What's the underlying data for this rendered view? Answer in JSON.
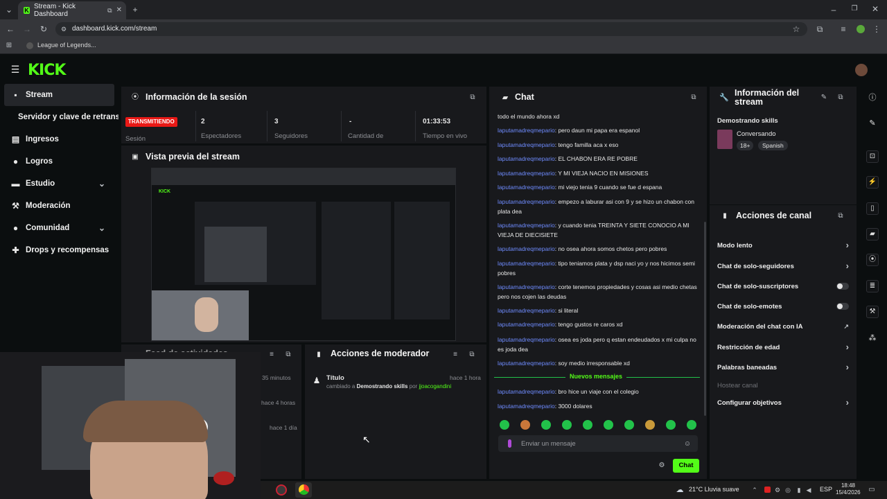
{
  "browser": {
    "tab_title": "Stream - Kick Dashboard",
    "url": "dashboard.kick.com/stream",
    "bookmark": "League of Legends..."
  },
  "sidebar": {
    "items": [
      {
        "label": "Stream",
        "icon": "stream-icon"
      },
      {
        "label": "Servidor y clave de retransmisión",
        "icon": ""
      },
      {
        "label": "Ingresos",
        "icon": "coins-icon"
      },
      {
        "label": "Logros",
        "icon": "trophy-icon"
      },
      {
        "label": "Estudio",
        "icon": "studio-icon"
      },
      {
        "label": "Moderación",
        "icon": "hammer-icon"
      },
      {
        "label": "Comunidad",
        "icon": "community-icon"
      },
      {
        "label": "Drops y recompensas",
        "icon": "gift-icon"
      }
    ]
  },
  "session": {
    "title": "Información de la sesión",
    "status": "TRANSMITIENDO",
    "status_label": "Sesión",
    "stats": [
      {
        "value": "2",
        "label": "Espectadores"
      },
      {
        "value": "3",
        "label": "Seguidores"
      },
      {
        "value": "-",
        "label": "Cantidad de"
      },
      {
        "value": "01:33:53",
        "label": "Tiempo en vivo"
      }
    ]
  },
  "preview": {
    "title": "Vista previa del stream"
  },
  "activity": {
    "title": "Feed de actividades",
    "times": [
      "35 minutos",
      "hace 4 horas",
      "hace 1 día"
    ]
  },
  "modactions": {
    "title": "Acciones de moderador",
    "entry_title": "Título",
    "entry_time": "hace 1 hora",
    "entry_prefix": "cambiado a",
    "entry_value": "Demostrando skills",
    "entry_by": "por",
    "entry_user": "jjoacogandini"
  },
  "chat": {
    "title": "Chat",
    "first_line": "todo el mundo ahora xd",
    "messages": [
      {
        "user": "laputamadreqmepario",
        "text": "pero daun mi papa era espanol"
      },
      {
        "user": "laputamadreqmepario",
        "text": "tengo familla aca x eso"
      },
      {
        "user": "laputamadreqmepario",
        "text": "EL CHABON ERA RE POBRE"
      },
      {
        "user": "laputamadreqmepario",
        "text": "Y MI VIEJA NACIO EN MISIONES"
      },
      {
        "user": "laputamadreqmepario",
        "text": "mi viejo tenia 9 cuando se fue d espana"
      },
      {
        "user": "laputamadreqmepario",
        "text": "empezo a laburar asi con 9 y se hizo un chabon con plata dea"
      },
      {
        "user": "laputamadreqmepario",
        "text": "y cuando tenia TREINTA Y SIETE CONOCIO A MI VIEJA DE DIECISIETE"
      },
      {
        "user": "laputamadreqmepario",
        "text": "no osea ahora somos chetos pero pobres"
      },
      {
        "user": "laputamadreqmepario",
        "text": "tipo teniamos plata y dsp naci yo y nos hicimos semi pobres"
      },
      {
        "user": "laputamadreqmepario",
        "text": "corte tenemos propiedades y cosas asi medio chetas pero nos cojen las deudas"
      },
      {
        "user": "laputamadreqmepario",
        "text": "si literal"
      },
      {
        "user": "laputamadreqmepario",
        "text": "tengo gustos re caros xd"
      },
      {
        "user": "laputamadreqmepario",
        "text": "osea es joda pero q estan endeudados x mi culpa no es joda dea"
      },
      {
        "user": "laputamadreqmepario",
        "text": "soy medio irresponsable xd"
      }
    ],
    "new_label": "Nuevos mensajes",
    "new_messages": [
      {
        "user": "laputamadreqmepario",
        "text": "bro hice un viaje con el colegio"
      },
      {
        "user": "laputamadreqmepario",
        "text": "3000 dolares"
      }
    ],
    "input_placeholder": "Enviar un mensaje",
    "send_label": "Chat"
  },
  "stream_info": {
    "title": "Información del stream",
    "stream_title": "Demostrando skills",
    "category": "Conversando",
    "tags": [
      "18+",
      "Spanish"
    ]
  },
  "channel_actions": {
    "title": "Acciones de canal",
    "items": [
      {
        "label": "Modo lento",
        "control": "chevron"
      },
      {
        "label": "Chat de solo-seguidores",
        "control": "chevron"
      },
      {
        "label": "Chat de solo-suscriptores",
        "control": "toggle"
      },
      {
        "label": "Chat de solo-emotes",
        "control": "toggle"
      },
      {
        "label": "Moderación del chat con IA",
        "control": "external"
      },
      {
        "label": "Restricción de edad",
        "control": "chevron"
      },
      {
        "label": "Palabras baneadas",
        "control": "chevron"
      },
      {
        "label": "Hostear canal",
        "control": "none"
      },
      {
        "label": "Configurar objetivos",
        "control": "chevron"
      }
    ]
  },
  "taskbar": {
    "weather": "21°C  Lluvia suave",
    "lang": "ESP",
    "time": "18:48",
    "date": "15/4/2026"
  },
  "colors": {
    "brand": "#53fc18",
    "live": "#e91916",
    "username": "#6f8cff"
  }
}
